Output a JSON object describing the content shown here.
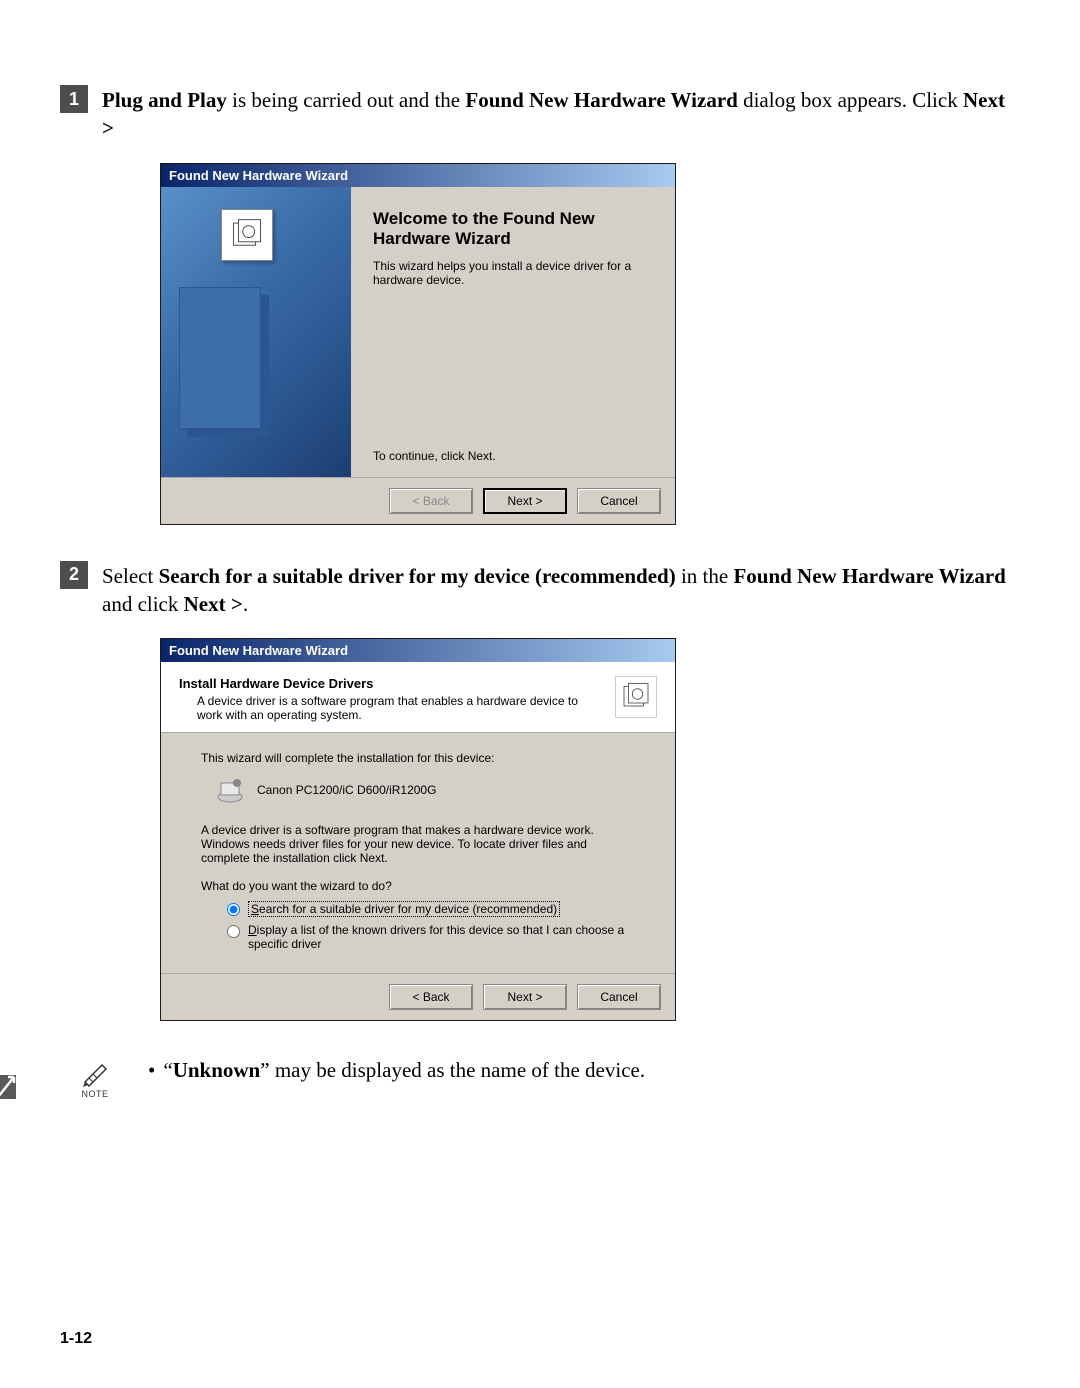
{
  "steps": [
    {
      "num": "1",
      "text_parts": {
        "a": "Plug and Play",
        "b": " is being carried out and the ",
        "c": "Found New Hardware Wizard",
        "d": " dialog box appears. Click ",
        "e": "Next >"
      }
    },
    {
      "num": "2",
      "text_parts": {
        "a": "Select ",
        "b": "Search for a suitable driver for my device (recommended)",
        "c": " in the ",
        "d": "Found New Hardware Wizard",
        "e": " and click ",
        "f": "Next >",
        "g": "."
      }
    }
  ],
  "wizard1": {
    "title": "Found New Hardware Wizard",
    "heading": "Welcome to the Found New Hardware Wizard",
    "sub": "This wizard helps you install a device driver for a hardware device.",
    "continue": "To continue, click Next.",
    "buttons": {
      "back": "< Back",
      "next": "Next >",
      "cancel": "Cancel"
    }
  },
  "wizard2": {
    "title": "Found New Hardware Wizard",
    "header_title": "Install Hardware Device Drivers",
    "header_desc": "A device driver is a software program that enables a hardware device to work with an operating system.",
    "line1": "This wizard will complete the installation for this device:",
    "device_name": "Canon PC1200/iC D600/iR1200G",
    "desc2": "A device driver is a software program that makes a hardware device work. Windows needs driver files for your new device. To locate driver files and complete the installation click Next.",
    "question": "What do you want the wizard to do?",
    "radio1": "Search for a suitable driver for my device (recommended)",
    "radio2": "Display a list of the known drivers for this device so that I can choose a specific driver",
    "buttons": {
      "back": "< Back",
      "next": "Next >",
      "cancel": "Cancel"
    }
  },
  "note": {
    "label": "NOTE",
    "bullet": "•",
    "text_parts": {
      "a": "“",
      "b": "Unknown",
      "c": "” may be displayed as the name of the device."
    }
  },
  "page_number": "1-12"
}
